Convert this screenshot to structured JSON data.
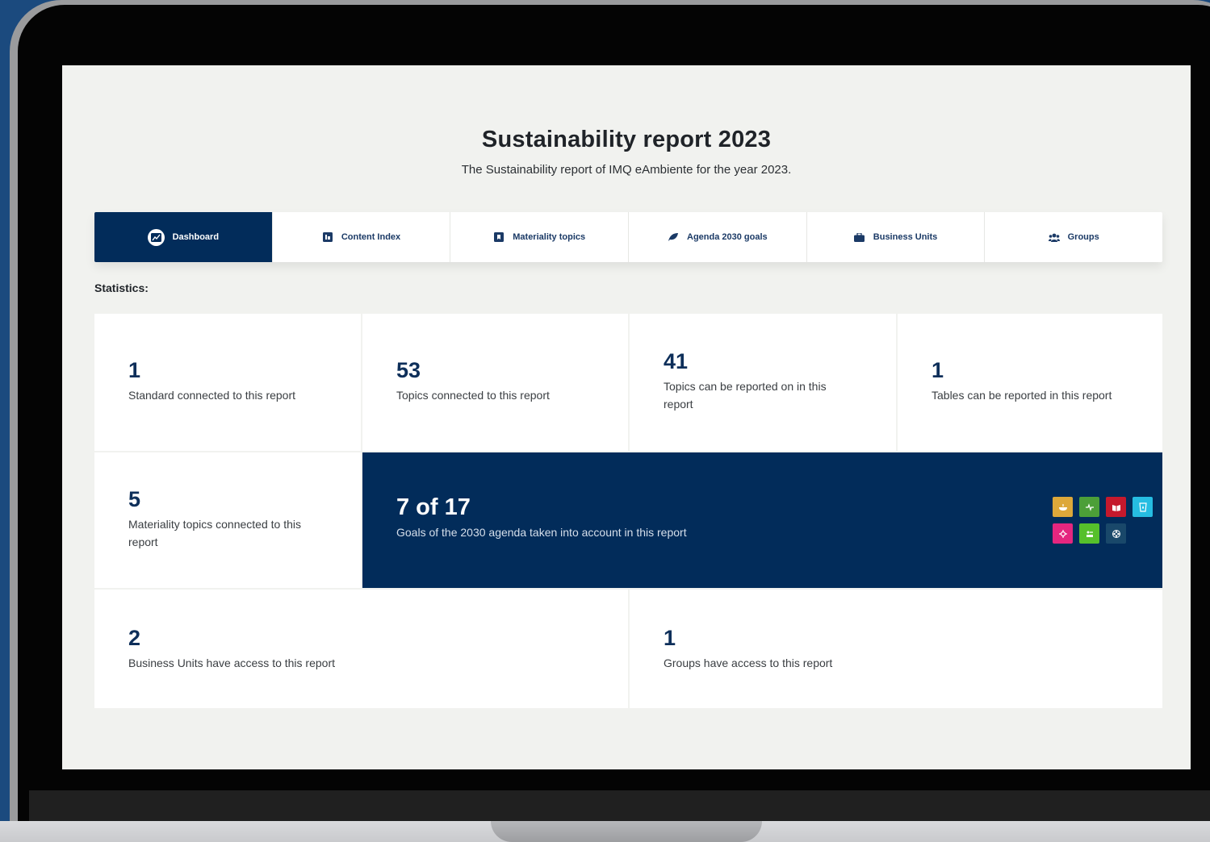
{
  "report": {
    "title": "Sustainability report 2023",
    "subtitle": "The Sustainability report of IMQ eAmbiente for the year 2023."
  },
  "tabs": [
    {
      "label": "Dashboard",
      "icon": "chart-icon",
      "active": true
    },
    {
      "label": "Content Index",
      "icon": "list-icon",
      "active": false
    },
    {
      "label": "Materiality topics",
      "icon": "bookmark-icon",
      "active": false
    },
    {
      "label": "Agenda 2030 goals",
      "icon": "leaf-icon",
      "active": false
    },
    {
      "label": "Business Units",
      "icon": "briefcase-icon",
      "active": false
    },
    {
      "label": "Groups",
      "icon": "users-icon",
      "active": false
    }
  ],
  "statistics": {
    "label": "Statistics:",
    "standard": {
      "value": "1",
      "text": "Standard connected to this report"
    },
    "topics": {
      "value": "53",
      "text": "Topics connected to this report"
    },
    "reportable_topics": {
      "value": "41",
      "text": "Topics can be reported on in this report"
    },
    "tables": {
      "value": "1",
      "text": "Tables can be reported in this report"
    },
    "materiality": {
      "value": "5",
      "text": "Materiality topics connected to this report"
    },
    "goals": {
      "value": "7 of 17",
      "text": "Goals of the 2030 agenda taken into account in this report"
    },
    "business_units": {
      "value": "2",
      "text": "Business Units have access to this report"
    },
    "groups": {
      "value": "1",
      "text": "Groups have access to this report"
    }
  },
  "sdg_icons": [
    {
      "name": "sdg-2-icon",
      "color": "#dda83a"
    },
    {
      "name": "sdg-3-icon",
      "color": "#4c9f38"
    },
    {
      "name": "sdg-4-icon",
      "color": "#c5192d"
    },
    {
      "name": "sdg-6-icon",
      "color": "#26bde2"
    },
    {
      "name": "sdg-5-icon",
      "color": "#e5267f"
    },
    {
      "name": "sdg-8-icon",
      "color": "#56c02b"
    },
    {
      "name": "sdg-17-icon",
      "color": "#19486a"
    }
  ],
  "colors": {
    "primary": "#022c5a",
    "accent_text": "#0e2f5a",
    "screen_bg": "#f1f2ef"
  }
}
